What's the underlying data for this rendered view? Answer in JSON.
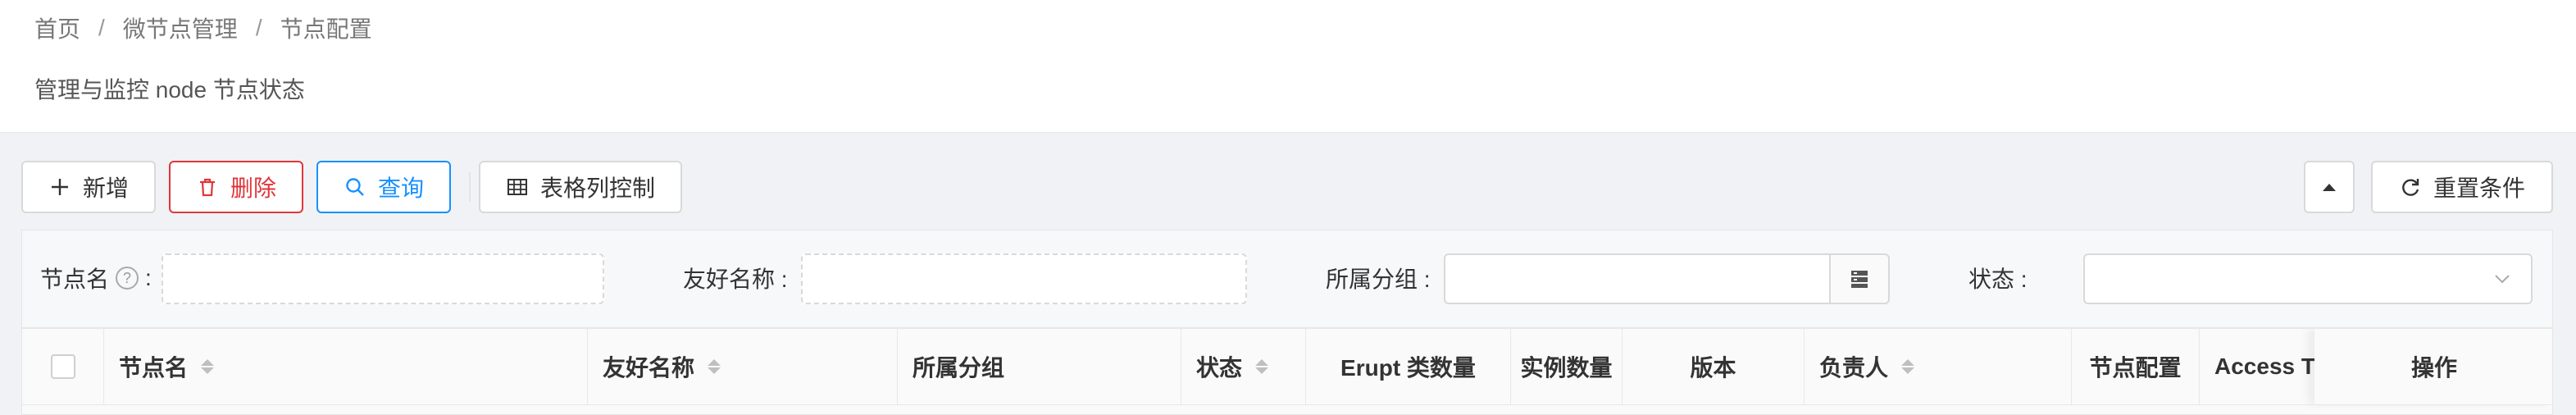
{
  "breadcrumb": {
    "items": [
      "首页",
      "微节点管理",
      "节点配置"
    ],
    "separator": "/"
  },
  "page": {
    "description": "管理与监控 node 节点状态"
  },
  "toolbar": {
    "add_label": "新增",
    "delete_label": "删除",
    "query_label": "查询",
    "columns_label": "表格列控制",
    "collapse_icon": "triangle-up-icon",
    "reset_label": "重置条件"
  },
  "search": {
    "node_name_label": "节点名",
    "friendly_name_label": "友好名称 :",
    "group_label": "所属分组 :",
    "status_label": "状态 :",
    "colon": ":",
    "node_name_value": "",
    "friendly_name_value": "",
    "group_value": "",
    "status_value": ""
  },
  "table": {
    "columns": [
      {
        "label": "节点名",
        "sortable": true
      },
      {
        "label": "友好名称",
        "sortable": true
      },
      {
        "label": "所属分组",
        "sortable": false
      },
      {
        "label": "状态",
        "sortable": true
      },
      {
        "label": "Erupt 类数量",
        "sortable": false
      },
      {
        "label": "实例数量",
        "sortable": false
      },
      {
        "label": "版本",
        "sortable": false
      },
      {
        "label": "负责人",
        "sortable": true
      },
      {
        "label": "节点配置",
        "sortable": false
      },
      {
        "label": "Access Token",
        "sortable": false
      },
      {
        "label": "操作",
        "sortable": false
      }
    ]
  },
  "colors": {
    "danger": "#e0363a",
    "primary": "#1890ff",
    "border": "#d9d9d9",
    "header_bg": "#fafafa"
  }
}
